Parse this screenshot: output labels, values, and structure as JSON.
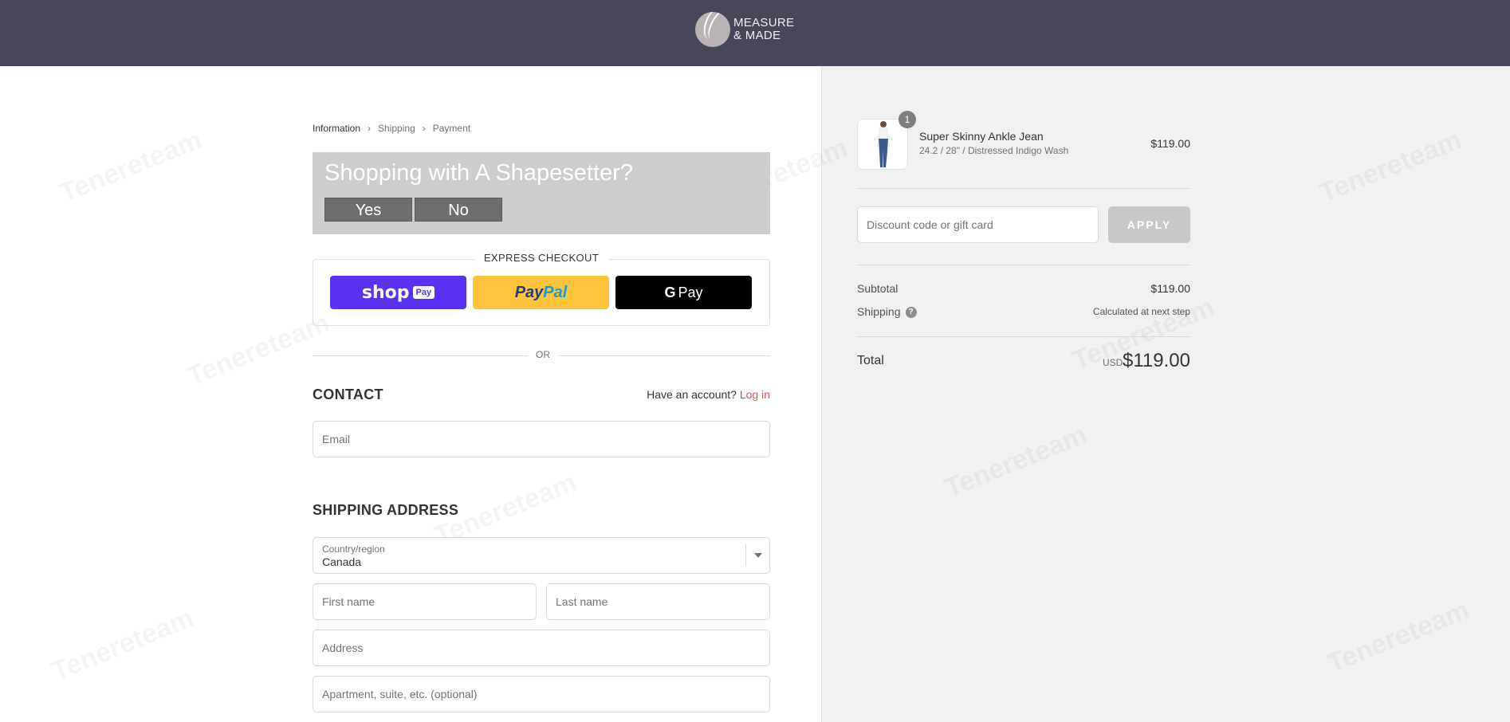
{
  "brand": {
    "line1": "MEASURE",
    "line2": "& MADE"
  },
  "breadcrumb": {
    "items": [
      "Information",
      "Shipping",
      "Payment"
    ]
  },
  "shapesetter": {
    "title": "Shopping with A Shapesetter?",
    "yes": "Yes",
    "no": "No"
  },
  "express": {
    "title": "EXPRESS CHECKOUT",
    "shop": "shop",
    "shop_pay": "Pay",
    "paypal_a": "Pay",
    "paypal_b": "Pal",
    "gpay_g": "G",
    "gpay": "Pay"
  },
  "or": "OR",
  "contact": {
    "title": "CONTACT",
    "account_prompt": "Have an account?",
    "login": "Log in",
    "email_placeholder": "Email"
  },
  "shipping": {
    "title": "SHIPPING ADDRESS",
    "country_label": "Country/region",
    "country_value": "Canada",
    "first_name": "First name",
    "last_name": "Last name",
    "address": "Address",
    "apartment": "Apartment, suite, etc. (optional)"
  },
  "order": {
    "item": {
      "name": "Super Skinny Ankle Jean",
      "variant": "24.2 / 28\" / Distressed Indigo Wash",
      "price": "$119.00",
      "quantity": "1"
    },
    "discount_placeholder": "Discount code or gift card",
    "apply": "APPLY",
    "subtotal_label": "Subtotal",
    "subtotal_value": "$119.00",
    "shipping_label": "Shipping",
    "shipping_value": "Calculated at next step",
    "total_label": "Total",
    "currency": "USD",
    "total_value": "$119.00"
  },
  "watermark": "Tenereteam",
  "colors": {
    "header": "#484659",
    "shop_pay": "#5a31f4",
    "paypal": "#ffc439",
    "login_link": "#c7565e",
    "sidebar": "#f0f0ee"
  }
}
